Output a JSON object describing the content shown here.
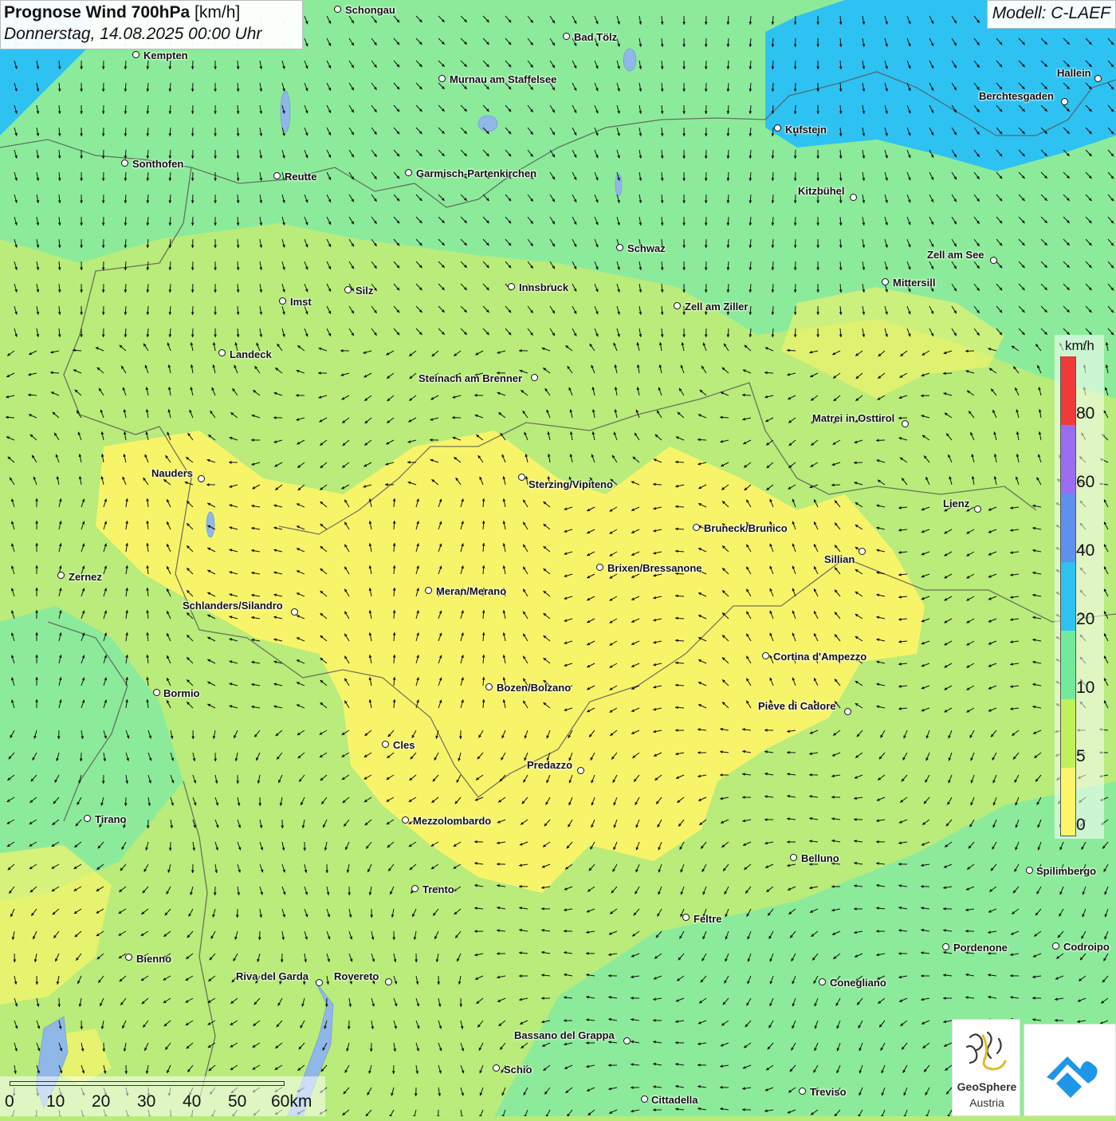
{
  "title": {
    "main": "Prognose Wind 700hPa",
    "unit": "[km/h]",
    "date": "Donnerstag, 14.08.2025 00:00 Uhr"
  },
  "model_label": "Modell: C-LAEF",
  "legend": {
    "unit": "km/h",
    "ticks": [
      "80",
      "60",
      "40",
      "20",
      "10",
      "5",
      "0"
    ],
    "colors": [
      "#ef3a3a",
      "#9b6cf0",
      "#5f8ff0",
      "#2ec2f2",
      "#72ea9c",
      "#c2f05a",
      "#fbf56a"
    ]
  },
  "scale_bar": {
    "labels": [
      "0",
      "10",
      "20",
      "30",
      "40",
      "50",
      "60km"
    ]
  },
  "cities": [
    {
      "name": "Schongau"
    },
    {
      "name": "Bad Tölz"
    },
    {
      "name": "Kempten"
    },
    {
      "name": "Murnau am Staffelsee"
    },
    {
      "name": "Hallein"
    },
    {
      "name": "Berchtesgaden"
    },
    {
      "name": "Kufstein"
    },
    {
      "name": "Sonthofen"
    },
    {
      "name": "Reutte"
    },
    {
      "name": "Garmisch-Partenkirchen"
    },
    {
      "name": "Kitzbühel"
    },
    {
      "name": "Schwaz"
    },
    {
      "name": "Zell am See"
    },
    {
      "name": "Mittersill"
    },
    {
      "name": "Innsbruck"
    },
    {
      "name": "Silz"
    },
    {
      "name": "Imst"
    },
    {
      "name": "Zell am Ziller"
    },
    {
      "name": "Landeck"
    },
    {
      "name": "Steinach am Brenner"
    },
    {
      "name": "Matrei in Osttirol"
    },
    {
      "name": "Nauders"
    },
    {
      "name": "Sterzing/Vipiteno"
    },
    {
      "name": "Lienz"
    },
    {
      "name": "Bruneck/Brunico"
    },
    {
      "name": "Sillian"
    },
    {
      "name": "Zernez"
    },
    {
      "name": "Brixen/Bressanone"
    },
    {
      "name": "Meran/Merano"
    },
    {
      "name": "Schlanders/Silandro"
    },
    {
      "name": "Cortina d'Ampezzo"
    },
    {
      "name": "Bozen/Bolzano"
    },
    {
      "name": "Bormio"
    },
    {
      "name": "Pieve di Cadore"
    },
    {
      "name": "Cles"
    },
    {
      "name": "Predazzo"
    },
    {
      "name": "Tirano"
    },
    {
      "name": "Mezzolombardo"
    },
    {
      "name": "Belluno"
    },
    {
      "name": "Spilimbergo"
    },
    {
      "name": "Trento"
    },
    {
      "name": "Feltre"
    },
    {
      "name": "Pordenone"
    },
    {
      "name": "Codroipo"
    },
    {
      "name": "Bienno"
    },
    {
      "name": "Riva del Garda"
    },
    {
      "name": "Rovereto"
    },
    {
      "name": "Conegliano"
    },
    {
      "name": "Bassano del Grappa"
    },
    {
      "name": "Schio"
    },
    {
      "name": "Treviso"
    },
    {
      "name": "Cittadella"
    }
  ],
  "logos": {
    "geosphere_line1": "GeoSphere",
    "geosphere_line2": "Austria"
  }
}
